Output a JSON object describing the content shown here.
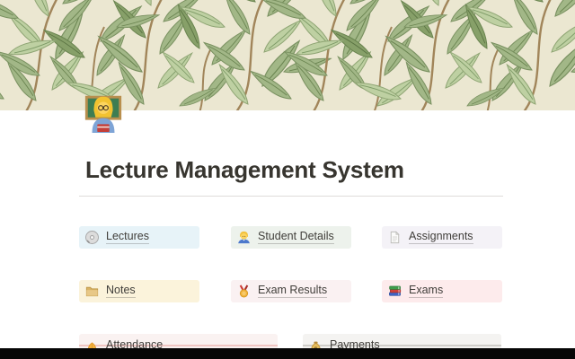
{
  "page": {
    "title": "Lecture Management System",
    "icon": "woman-teacher-emoji",
    "banner": "willow-leaf-pattern-cover"
  },
  "colors": {
    "title_text": "#37352f",
    "link_text": "#403e3a",
    "divider": "#dedcd9",
    "banner_background": "#ebe7d1",
    "banner_leaf_green": "#a2b787",
    "banner_branch_brown": "#a1855a",
    "bottom_bar": "#060606"
  },
  "cards": [
    {
      "label": "Lectures",
      "icon": "cd-icon",
      "bg": "#e7f3f8"
    },
    {
      "label": "Student Details",
      "icon": "student-icon",
      "bg": "#edf2ec"
    },
    {
      "label": "Assignments",
      "icon": "page-icon",
      "bg": "#f4f2f7"
    },
    {
      "label": "Notes",
      "icon": "folder-icon",
      "bg": "#fbf3db"
    },
    {
      "label": "Exam Results",
      "icon": "medal-icon",
      "bg": "#faf1f2"
    },
    {
      "label": "Exams",
      "icon": "books-icon",
      "bg": "#fdebec"
    },
    {
      "label": "Attendance",
      "icon": "raised-hands-icon",
      "bg": "#faf2f1",
      "divider_color": "#f0c6c3"
    },
    {
      "label": "Payments",
      "icon": "money-bag-icon",
      "bg": "#f4f3f1",
      "divider_color": "#cfcdc9"
    }
  ]
}
